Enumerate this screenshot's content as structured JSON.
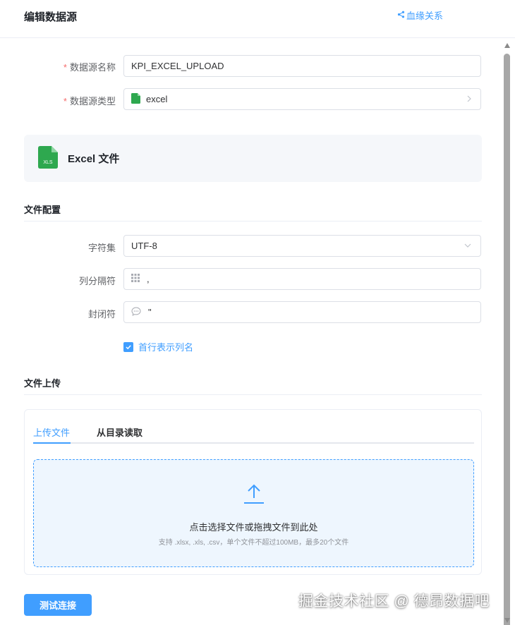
{
  "header": {
    "title": "编辑数据源",
    "lineage_label": "血缘关系"
  },
  "form": {
    "name_label": "数据源名称",
    "name_value": "KPI_EXCEL_UPLOAD",
    "type_label": "数据源类型",
    "type_value": "excel"
  },
  "excel_card": {
    "title": "Excel 文件",
    "icon_text": "XLS"
  },
  "file_config": {
    "section_title": "文件配置",
    "charset_label": "字符集",
    "charset_value": "UTF-8",
    "delimiter_label": "列分隔符",
    "delimiter_value": ",",
    "enclosure_label": "封闭符",
    "enclosure_value": "\"",
    "header_checkbox_label": "首行表示列名",
    "header_checkbox_checked": true
  },
  "upload": {
    "section_title": "文件上传",
    "tabs": [
      {
        "label": "上传文件",
        "active": true
      },
      {
        "label": "从目录读取",
        "active": false
      }
    ],
    "dropzone_text": "点击选择文件或拖拽文件到此处",
    "dropzone_hint": "支持 .xlsx, .xls, .csv，单个文件不超过100MB，最多20个文件"
  },
  "actions": {
    "test_button": "测试连接"
  },
  "watermark": "掘金技术社区 @ 德昂数据吧",
  "colors": {
    "primary": "#409eff",
    "required": "#f56c6c",
    "excel_green": "#2ea84f"
  }
}
